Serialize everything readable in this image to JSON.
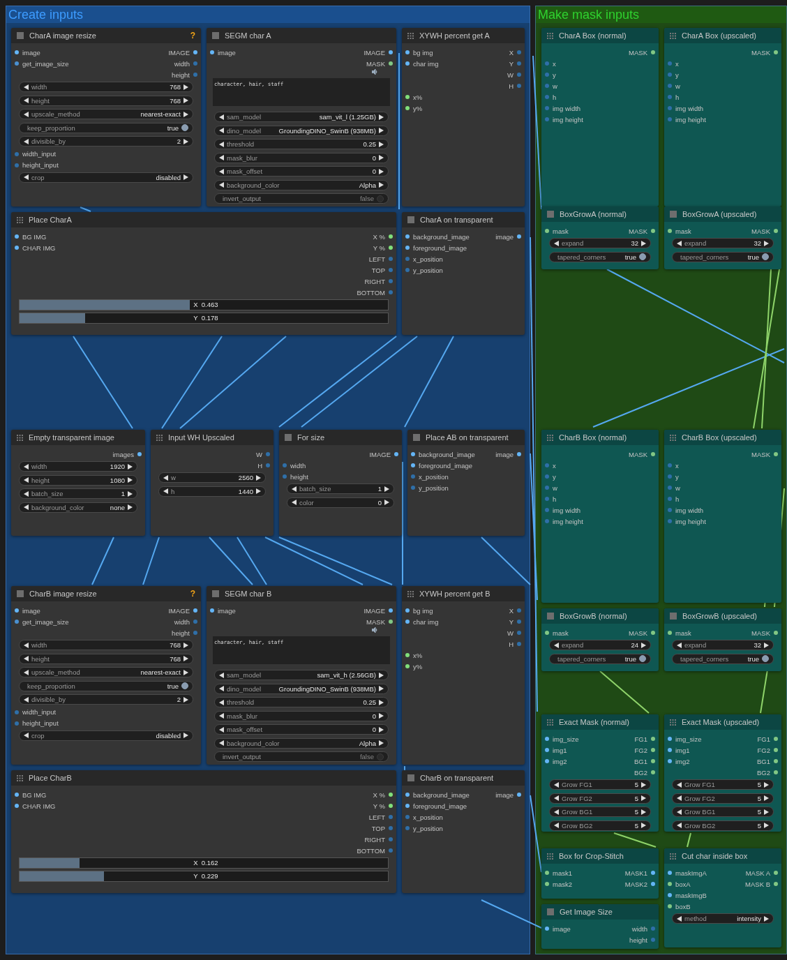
{
  "groups": [
    {
      "title": "Create inputs",
      "color": "#17406f",
      "nodes": [
        {
          "title": "CharA image resize",
          "kind": "square",
          "badge": "?",
          "rows": [
            {
              "kind": "io",
              "in": {
                "label": "image",
                "color": "#64b5f6"
              },
              "out": {
                "label": "IMAGE",
                "color": "#64b5f6"
              }
            },
            {
              "kind": "io",
              "in": {
                "label": "get_image_size",
                "color": "#4a90d0"
              },
              "out": {
                "label": "width",
                "color": "#2f6fa8"
              }
            },
            {
              "kind": "io",
              "out": {
                "label": "height",
                "color": "#2f6fa8"
              }
            },
            {
              "kind": "widget",
              "label": "width",
              "value": "768"
            },
            {
              "kind": "widget",
              "label": "height",
              "value": "768"
            },
            {
              "kind": "widget",
              "label": "upscale_method",
              "value": "nearest-exact"
            },
            {
              "kind": "toggle",
              "label": "keep_proportion",
              "value": "true",
              "on": true
            },
            {
              "kind": "widget",
              "label": "divisible_by",
              "value": "2"
            },
            {
              "kind": "io",
              "in": {
                "label": "width_input",
                "color": "#2f6fa8"
              }
            },
            {
              "kind": "io",
              "in": {
                "label": "height_input",
                "color": "#2f6fa8"
              }
            },
            {
              "kind": "widget",
              "label": "crop",
              "value": "disabled"
            }
          ]
        },
        {
          "title": "SEGM char A",
          "kind": "square",
          "rows": [
            {
              "kind": "io",
              "in": {
                "label": "image",
                "color": "#64b5f6"
              },
              "out": {
                "label": "IMAGE",
                "color": "#64b5f6"
              }
            },
            {
              "kind": "io",
              "out": {
                "label": "MASK",
                "color": "#81c784"
              }
            },
            {
              "kind": "audio"
            },
            {
              "kind": "text",
              "value": "character, hair, staff"
            },
            {
              "kind": "widget",
              "label": "sam_model",
              "value": "sam_vit_l (1.25GB)"
            },
            {
              "kind": "widget",
              "label": "dino_model",
              "value": "GroundingDINO_SwinB (938MB)"
            },
            {
              "kind": "widget",
              "label": "threshold",
              "value": "0.25"
            },
            {
              "kind": "widget",
              "label": "mask_blur",
              "value": "0"
            },
            {
              "kind": "widget",
              "label": "mask_offset",
              "value": "0"
            },
            {
              "kind": "widget",
              "label": "background_color",
              "value": "Alpha"
            },
            {
              "kind": "toggle",
              "label": "invert_output",
              "value": "false",
              "on": false
            }
          ]
        },
        {
          "title": "XYWH percent get A",
          "kind": "grip",
          "rows": [
            {
              "kind": "io",
              "in": {
                "label": "bg img",
                "color": "#64b5f6"
              },
              "out": {
                "label": "X",
                "color": "#2f6fa8"
              }
            },
            {
              "kind": "io",
              "in": {
                "label": "char img",
                "color": "#64b5f6"
              },
              "out": {
                "label": "Y",
                "color": "#2f6fa8"
              }
            },
            {
              "kind": "io",
              "out": {
                "label": "W",
                "color": "#2f6fa8"
              }
            },
            {
              "kind": "io",
              "out": {
                "label": "H",
                "color": "#2f6fa8"
              }
            },
            {
              "kind": "io",
              "in": {
                "label": "x%",
                "color": "#81e07a"
              }
            },
            {
              "kind": "io",
              "in": {
                "label": "y%",
                "color": "#81e07a"
              }
            }
          ]
        },
        {
          "title": "Place CharA",
          "kind": "grip",
          "rows": [
            {
              "kind": "io",
              "in": {
                "label": "BG IMG",
                "color": "#64b5f6"
              },
              "out": {
                "label": "X %",
                "color": "#81e07a"
              }
            },
            {
              "kind": "io",
              "in": {
                "label": "CHAR IMG",
                "color": "#64b5f6"
              },
              "out": {
                "label": "Y %",
                "color": "#81e07a"
              }
            },
            {
              "kind": "io",
              "out": {
                "label": "LEFT",
                "color": "#2f6fa8"
              }
            },
            {
              "kind": "io",
              "out": {
                "label": "TOP",
                "color": "#2f6fa8"
              }
            },
            {
              "kind": "io",
              "out": {
                "label": "RIGHT",
                "color": "#2f6fa8"
              }
            },
            {
              "kind": "io",
              "out": {
                "label": "BOTTOM",
                "color": "#2f6fa8"
              }
            },
            {
              "kind": "slider",
              "label": "X",
              "value": "0.463",
              "level": 0.463
            },
            {
              "kind": "slider",
              "label": "Y",
              "value": "0.178",
              "level": 0.178
            }
          ]
        },
        {
          "title": "CharA on transparent",
          "kind": "square",
          "rows": [
            {
              "kind": "io",
              "in": {
                "label": "background_image",
                "color": "#64b5f6"
              },
              "out": {
                "label": "image",
                "color": "#64b5f6"
              }
            },
            {
              "kind": "io",
              "in": {
                "label": "foreground_image",
                "color": "#64b5f6"
              }
            },
            {
              "kind": "io",
              "in": {
                "label": "x_position",
                "color": "#2f6fa8"
              }
            },
            {
              "kind": "io",
              "in": {
                "label": "y_position",
                "color": "#2f6fa8"
              }
            }
          ]
        },
        {
          "title": "Empty transparent image",
          "kind": "grip",
          "rows": [
            {
              "kind": "io",
              "out": {
                "label": "images",
                "color": "#64b5f6"
              }
            },
            {
              "kind": "widget",
              "label": "width",
              "value": "1920"
            },
            {
              "kind": "widget",
              "label": "height",
              "value": "1080"
            },
            {
              "kind": "widget",
              "label": "batch_size",
              "value": "1"
            },
            {
              "kind": "widget",
              "label": "background_color",
              "value": "none"
            }
          ]
        },
        {
          "title": "Input WH Upscaled",
          "kind": "grip",
          "rows": [
            {
              "kind": "io",
              "out": {
                "label": "W",
                "color": "#2f6fa8"
              }
            },
            {
              "kind": "io",
              "out": {
                "label": "H",
                "color": "#2f6fa8"
              }
            },
            {
              "kind": "widget",
              "label": "w",
              "value": "2560"
            },
            {
              "kind": "widget",
              "label": "h",
              "value": "1440"
            }
          ]
        },
        {
          "title": "For size",
          "kind": "square",
          "rows": [
            {
              "kind": "io",
              "out": {
                "label": "IMAGE",
                "color": "#64b5f6"
              }
            },
            {
              "kind": "io",
              "in": {
                "label": "width",
                "color": "#2f6fa8"
              }
            },
            {
              "kind": "io",
              "in": {
                "label": "height",
                "color": "#2f6fa8"
              }
            },
            {
              "kind": "widget",
              "label": "batch_size",
              "value": "1"
            },
            {
              "kind": "widget",
              "label": "color",
              "value": "0"
            }
          ]
        },
        {
          "title": "Place AB on transparent",
          "kind": "square",
          "rows": [
            {
              "kind": "io",
              "in": {
                "label": "background_image",
                "color": "#64b5f6"
              },
              "out": {
                "label": "image",
                "color": "#64b5f6"
              }
            },
            {
              "kind": "io",
              "in": {
                "label": "foreground_image",
                "color": "#64b5f6"
              }
            },
            {
              "kind": "io",
              "in": {
                "label": "x_position",
                "color": "#2f6fa8"
              }
            },
            {
              "kind": "io",
              "in": {
                "label": "y_position",
                "color": "#2f6fa8"
              }
            }
          ]
        },
        {
          "title": "CharB image resize",
          "kind": "square",
          "badge": "?",
          "rows": [
            {
              "kind": "io",
              "in": {
                "label": "image",
                "color": "#64b5f6"
              },
              "out": {
                "label": "IMAGE",
                "color": "#64b5f6"
              }
            },
            {
              "kind": "io",
              "in": {
                "label": "get_image_size",
                "color": "#4a90d0"
              },
              "out": {
                "label": "width",
                "color": "#2f6fa8"
              }
            },
            {
              "kind": "io",
              "out": {
                "label": "height",
                "color": "#2f6fa8"
              }
            },
            {
              "kind": "widget",
              "label": "width",
              "value": "768"
            },
            {
              "kind": "widget",
              "label": "height",
              "value": "768"
            },
            {
              "kind": "widget",
              "label": "upscale_method",
              "value": "nearest-exact"
            },
            {
              "kind": "toggle",
              "label": "keep_proportion",
              "value": "true",
              "on": true
            },
            {
              "kind": "widget",
              "label": "divisible_by",
              "value": "2"
            },
            {
              "kind": "io",
              "in": {
                "label": "width_input",
                "color": "#2f6fa8"
              }
            },
            {
              "kind": "io",
              "in": {
                "label": "height_input",
                "color": "#2f6fa8"
              }
            },
            {
              "kind": "widget",
              "label": "crop",
              "value": "disabled"
            }
          ]
        },
        {
          "title": "SEGM char B",
          "kind": "square",
          "rows": [
            {
              "kind": "io",
              "in": {
                "label": "image",
                "color": "#64b5f6"
              },
              "out": {
                "label": "IMAGE",
                "color": "#64b5f6"
              }
            },
            {
              "kind": "io",
              "out": {
                "label": "MASK",
                "color": "#81c784"
              }
            },
            {
              "kind": "audio"
            },
            {
              "kind": "text",
              "value": "character, hair, staff"
            },
            {
              "kind": "widget",
              "label": "sam_model",
              "value": "sam_vit_h (2.56GB)"
            },
            {
              "kind": "widget",
              "label": "dino_model",
              "value": "GroundingDINO_SwinB (938MB)"
            },
            {
              "kind": "widget",
              "label": "threshold",
              "value": "0.25"
            },
            {
              "kind": "widget",
              "label": "mask_blur",
              "value": "0"
            },
            {
              "kind": "widget",
              "label": "mask_offset",
              "value": "0"
            },
            {
              "kind": "widget",
              "label": "background_color",
              "value": "Alpha"
            },
            {
              "kind": "toggle",
              "label": "invert_output",
              "value": "false",
              "on": false
            }
          ]
        },
        {
          "title": "XYWH percent get B",
          "kind": "grip",
          "rows": [
            {
              "kind": "io",
              "in": {
                "label": "bg img",
                "color": "#64b5f6"
              },
              "out": {
                "label": "X",
                "color": "#2f6fa8"
              }
            },
            {
              "kind": "io",
              "in": {
                "label": "char img",
                "color": "#64b5f6"
              },
              "out": {
                "label": "Y",
                "color": "#2f6fa8"
              }
            },
            {
              "kind": "io",
              "out": {
                "label": "W",
                "color": "#2f6fa8"
              }
            },
            {
              "kind": "io",
              "out": {
                "label": "H",
                "color": "#2f6fa8"
              }
            },
            {
              "kind": "io",
              "in": {
                "label": "x%",
                "color": "#81e07a"
              }
            },
            {
              "kind": "io",
              "in": {
                "label": "y%",
                "color": "#81e07a"
              }
            }
          ]
        },
        {
          "title": "Place CharB",
          "kind": "grip",
          "rows": [
            {
              "kind": "io",
              "in": {
                "label": "BG IMG",
                "color": "#64b5f6"
              },
              "out": {
                "label": "X %",
                "color": "#81e07a"
              }
            },
            {
              "kind": "io",
              "in": {
                "label": "CHAR IMG",
                "color": "#64b5f6"
              },
              "out": {
                "label": "Y %",
                "color": "#81e07a"
              }
            },
            {
              "kind": "io",
              "out": {
                "label": "LEFT",
                "color": "#2f6fa8"
              }
            },
            {
              "kind": "io",
              "out": {
                "label": "TOP",
                "color": "#2f6fa8"
              }
            },
            {
              "kind": "io",
              "out": {
                "label": "RIGHT",
                "color": "#2f6fa8"
              }
            },
            {
              "kind": "io",
              "out": {
                "label": "BOTTOM",
                "color": "#2f6fa8"
              }
            },
            {
              "kind": "slider",
              "label": "X",
              "value": "0.162",
              "level": 0.162
            },
            {
              "kind": "slider",
              "label": "Y",
              "value": "0.229",
              "level": 0.229
            }
          ]
        },
        {
          "title": "CharB on transparent",
          "kind": "square",
          "rows": [
            {
              "kind": "io",
              "in": {
                "label": "background_image",
                "color": "#64b5f6"
              },
              "out": {
                "label": "image",
                "color": "#64b5f6"
              }
            },
            {
              "kind": "io",
              "in": {
                "label": "foreground_image",
                "color": "#64b5f6"
              }
            },
            {
              "kind": "io",
              "in": {
                "label": "x_position",
                "color": "#2f6fa8"
              }
            },
            {
              "kind": "io",
              "in": {
                "label": "y_position",
                "color": "#2f6fa8"
              }
            }
          ]
        }
      ]
    },
    {
      "title": "Make mask inputs",
      "color": "#1f4a15",
      "nodes": [
        {
          "title": "CharA Box (normal)",
          "kind": "grip",
          "rows": [
            {
              "kind": "io",
              "out": {
                "label": "MASK",
                "color": "#81c784"
              }
            },
            {
              "kind": "io",
              "in": {
                "label": "x",
                "color": "#2f6fa8"
              }
            },
            {
              "kind": "io",
              "in": {
                "label": "y",
                "color": "#2f6fa8"
              }
            },
            {
              "kind": "io",
              "in": {
                "label": "w",
                "color": "#2f6fa8"
              }
            },
            {
              "kind": "io",
              "in": {
                "label": "h",
                "color": "#2f6fa8"
              }
            },
            {
              "kind": "io",
              "in": {
                "label": "img width",
                "color": "#2f6fa8"
              }
            },
            {
              "kind": "io",
              "in": {
                "label": "img height",
                "color": "#2f6fa8"
              }
            }
          ]
        },
        {
          "title": "CharA Box (upscaled)",
          "kind": "grip",
          "rows": [
            {
              "kind": "io",
              "out": {
                "label": "MASK",
                "color": "#81c784"
              }
            },
            {
              "kind": "io",
              "in": {
                "label": "x",
                "color": "#2f6fa8"
              }
            },
            {
              "kind": "io",
              "in": {
                "label": "y",
                "color": "#2f6fa8"
              }
            },
            {
              "kind": "io",
              "in": {
                "label": "w",
                "color": "#2f6fa8"
              }
            },
            {
              "kind": "io",
              "in": {
                "label": "h",
                "color": "#2f6fa8"
              }
            },
            {
              "kind": "io",
              "in": {
                "label": "img width",
                "color": "#2f6fa8"
              }
            },
            {
              "kind": "io",
              "in": {
                "label": "img height",
                "color": "#2f6fa8"
              }
            }
          ]
        },
        {
          "title": "BoxGrowA (normal)",
          "kind": "square",
          "rows": [
            {
              "kind": "io",
              "in": {
                "label": "mask",
                "color": "#81c784"
              },
              "out": {
                "label": "MASK",
                "color": "#81c784"
              }
            },
            {
              "kind": "widget",
              "label": "expand",
              "value": "32"
            },
            {
              "kind": "toggle",
              "label": "tapered_corners",
              "value": "true",
              "on": true
            }
          ]
        },
        {
          "title": "BoxGrowA (upscaled)",
          "kind": "square",
          "rows": [
            {
              "kind": "io",
              "in": {
                "label": "mask",
                "color": "#81c784"
              },
              "out": {
                "label": "MASK",
                "color": "#81c784"
              }
            },
            {
              "kind": "widget",
              "label": "expand",
              "value": "32"
            },
            {
              "kind": "toggle",
              "label": "tapered_corners",
              "value": "true",
              "on": true
            }
          ]
        },
        {
          "title": "CharB Box (normal)",
          "kind": "grip",
          "rows": [
            {
              "kind": "io",
              "out": {
                "label": "MASK",
                "color": "#81c784"
              }
            },
            {
              "kind": "io",
              "in": {
                "label": "x",
                "color": "#2f6fa8"
              }
            },
            {
              "kind": "io",
              "in": {
                "label": "y",
                "color": "#2f6fa8"
              }
            },
            {
              "kind": "io",
              "in": {
                "label": "w",
                "color": "#2f6fa8"
              }
            },
            {
              "kind": "io",
              "in": {
                "label": "h",
                "color": "#2f6fa8"
              }
            },
            {
              "kind": "io",
              "in": {
                "label": "img width",
                "color": "#2f6fa8"
              }
            },
            {
              "kind": "io",
              "in": {
                "label": "img height",
                "color": "#2f6fa8"
              }
            }
          ]
        },
        {
          "title": "CharB Box (upscaled)",
          "kind": "grip",
          "rows": [
            {
              "kind": "io",
              "out": {
                "label": "MASK",
                "color": "#81c784"
              }
            },
            {
              "kind": "io",
              "in": {
                "label": "x",
                "color": "#2f6fa8"
              }
            },
            {
              "kind": "io",
              "in": {
                "label": "y",
                "color": "#2f6fa8"
              }
            },
            {
              "kind": "io",
              "in": {
                "label": "w",
                "color": "#2f6fa8"
              }
            },
            {
              "kind": "io",
              "in": {
                "label": "h",
                "color": "#2f6fa8"
              }
            },
            {
              "kind": "io",
              "in": {
                "label": "img width",
                "color": "#2f6fa8"
              }
            },
            {
              "kind": "io",
              "in": {
                "label": "img height",
                "color": "#2f6fa8"
              }
            }
          ]
        },
        {
          "title": "BoxGrowB (normal)",
          "kind": "square",
          "rows": [
            {
              "kind": "io",
              "in": {
                "label": "mask",
                "color": "#81c784"
              },
              "out": {
                "label": "MASK",
                "color": "#81c784"
              }
            },
            {
              "kind": "widget",
              "label": "expand",
              "value": "24"
            },
            {
              "kind": "toggle",
              "label": "tapered_corners",
              "value": "true",
              "on": true
            }
          ]
        },
        {
          "title": "BoxGrowB (upscaled)",
          "kind": "square",
          "rows": [
            {
              "kind": "io",
              "in": {
                "label": "mask",
                "color": "#81c784"
              },
              "out": {
                "label": "MASK",
                "color": "#81c784"
              }
            },
            {
              "kind": "widget",
              "label": "expand",
              "value": "32"
            },
            {
              "kind": "toggle",
              "label": "tapered_corners",
              "value": "true",
              "on": true
            }
          ]
        },
        {
          "title": "Exact Mask (normal)",
          "kind": "grip",
          "rows": [
            {
              "kind": "io",
              "in": {
                "label": "img_size",
                "color": "#64b5f6"
              },
              "out": {
                "label": "FG1",
                "color": "#81c784"
              }
            },
            {
              "kind": "io",
              "in": {
                "label": "img1",
                "color": "#64b5f6"
              },
              "out": {
                "label": "FG2",
                "color": "#81c784"
              }
            },
            {
              "kind": "io",
              "in": {
                "label": "img2",
                "color": "#64b5f6"
              },
              "out": {
                "label": "BG1",
                "color": "#81c784"
              }
            },
            {
              "kind": "io",
              "out": {
                "label": "BG2",
                "color": "#81c784"
              }
            },
            {
              "kind": "widget",
              "label": "Grow FG1",
              "value": "5"
            },
            {
              "kind": "widget",
              "label": "Grow FG2",
              "value": "5"
            },
            {
              "kind": "widget",
              "label": "Grow BG1",
              "value": "5"
            },
            {
              "kind": "widget",
              "label": "Grow BG2",
              "value": "5"
            }
          ]
        },
        {
          "title": "Exact Mask (upscaled)",
          "kind": "grip",
          "rows": [
            {
              "kind": "io",
              "in": {
                "label": "img_size",
                "color": "#64b5f6"
              },
              "out": {
                "label": "FG1",
                "color": "#81c784"
              }
            },
            {
              "kind": "io",
              "in": {
                "label": "img1",
                "color": "#64b5f6"
              },
              "out": {
                "label": "FG2",
                "color": "#81c784"
              }
            },
            {
              "kind": "io",
              "in": {
                "label": "img2",
                "color": "#64b5f6"
              },
              "out": {
                "label": "BG1",
                "color": "#81c784"
              }
            },
            {
              "kind": "io",
              "out": {
                "label": "BG2",
                "color": "#81c784"
              }
            },
            {
              "kind": "widget",
              "label": "Grow FG1",
              "value": "5"
            },
            {
              "kind": "widget",
              "label": "Grow FG2",
              "value": "5"
            },
            {
              "kind": "widget",
              "label": "Grow BG1",
              "value": "5"
            },
            {
              "kind": "widget",
              "label": "Grow BG2",
              "value": "5"
            }
          ]
        },
        {
          "title": "Box for Crop-Stitch",
          "kind": "grip",
          "rows": [
            {
              "kind": "io",
              "in": {
                "label": "mask1",
                "color": "#81c784"
              },
              "out": {
                "label": "MASK1",
                "color": "#64b5f6"
              }
            },
            {
              "kind": "io",
              "in": {
                "label": "mask2",
                "color": "#81c784"
              },
              "out": {
                "label": "MASK2",
                "color": "#64b5f6"
              }
            }
          ]
        },
        {
          "title": "Cut char inside box",
          "kind": "grip",
          "rows": [
            {
              "kind": "io",
              "in": {
                "label": "maskImgA",
                "color": "#64b5f6"
              },
              "out": {
                "label": "MASK A",
                "color": "#81c784"
              }
            },
            {
              "kind": "io",
              "in": {
                "label": "boxA",
                "color": "#81c784"
              },
              "out": {
                "label": "MASK B",
                "color": "#81c784"
              }
            },
            {
              "kind": "io",
              "in": {
                "label": "maskImgB",
                "color": "#64b5f6"
              }
            },
            {
              "kind": "io",
              "in": {
                "label": "boxB",
                "color": "#81c784"
              }
            },
            {
              "kind": "widget",
              "label": "method",
              "value": "intensity"
            }
          ]
        },
        {
          "title": "Get Image Size",
          "kind": "square",
          "rows": [
            {
              "kind": "io",
              "in": {
                "label": "image",
                "color": "#64b5f6"
              },
              "out": {
                "label": "width",
                "color": "#2f6fa8"
              }
            },
            {
              "kind": "io",
              "out": {
                "label": "height",
                "color": "#2f6fa8"
              }
            }
          ]
        }
      ]
    }
  ]
}
